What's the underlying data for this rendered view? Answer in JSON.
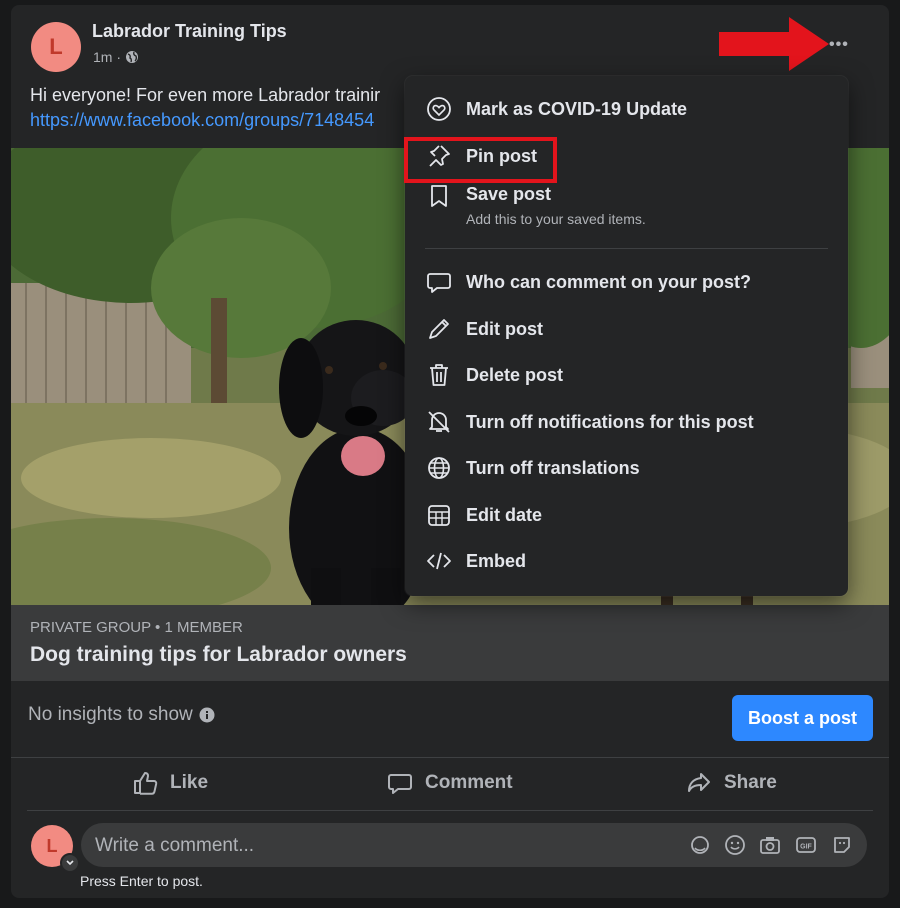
{
  "post": {
    "page_name": "Labrador Training Tips",
    "avatar_letter": "L",
    "time": "1m ·",
    "text": "Hi everyone! For even more Labrador trainir",
    "link": "https://www.facebook.com/groups/7148454",
    "options_label": "•••"
  },
  "group_card": {
    "meta": "PRIVATE GROUP • 1 MEMBER",
    "title": "Dog training tips for Labrador owners"
  },
  "insights": {
    "text": "No insights to show",
    "boost_label": "Boost a post"
  },
  "actions": {
    "like": "Like",
    "comment": "Comment",
    "share": "Share"
  },
  "comment_box": {
    "avatar_letter": "L",
    "placeholder": "Write a comment...",
    "hint": "Press Enter to post."
  },
  "menu": {
    "items": [
      {
        "label": "Mark as COVID-19 Update",
        "icon": "covid-update-icon"
      },
      {
        "label": "Pin post",
        "icon": "pin-icon"
      },
      {
        "label": "Save post",
        "sublabel": "Add this to your saved items.",
        "icon": "bookmark-icon"
      },
      {
        "label": "Who can comment on your post?",
        "icon": "comment-bubble-icon"
      },
      {
        "label": "Edit post",
        "icon": "pencil-icon"
      },
      {
        "label": "Delete post",
        "icon": "trash-icon"
      },
      {
        "label": "Turn off notifications for this post",
        "icon": "bell-off-icon"
      },
      {
        "label": "Turn off translations",
        "icon": "globe-icon"
      },
      {
        "label": "Edit date",
        "icon": "calendar-icon"
      },
      {
        "label": "Embed",
        "icon": "embed-icon"
      }
    ]
  },
  "colors": {
    "background": "#18191a",
    "card": "#242526",
    "accent": "#2d88ff",
    "link": "#4599ff",
    "highlight": "#e3141c"
  }
}
